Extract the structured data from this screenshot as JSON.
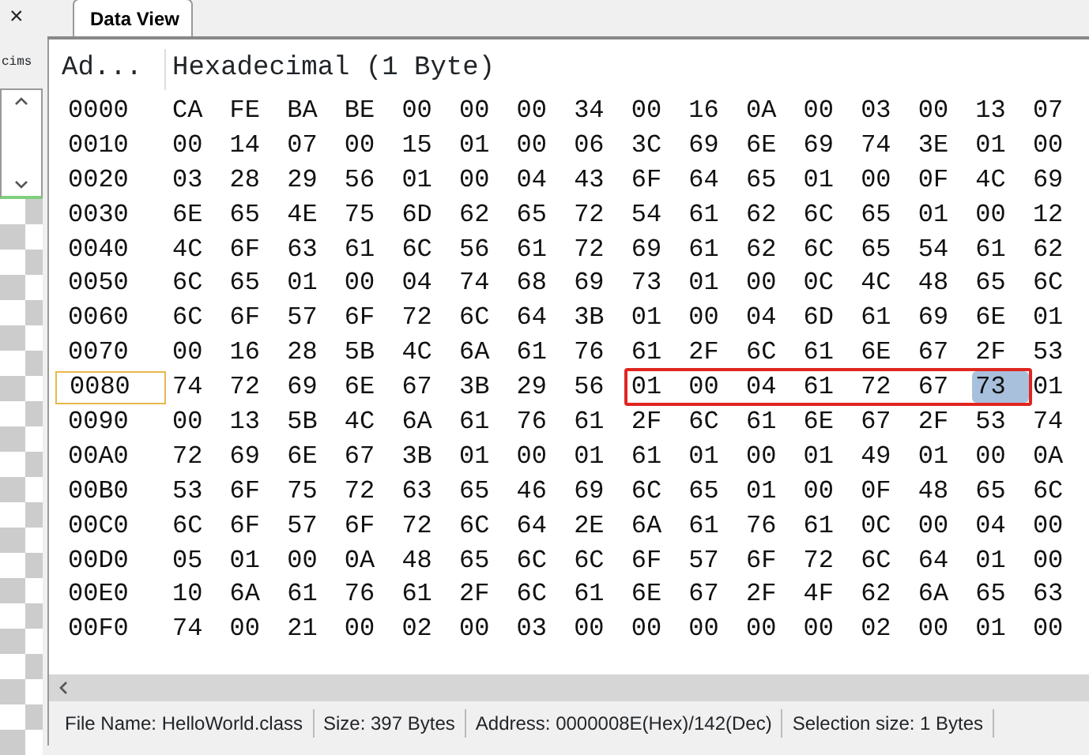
{
  "side_panel": {
    "close": "×",
    "label": "cims"
  },
  "tabs": [
    {
      "label": "Data View",
      "selected": true
    }
  ],
  "columns": [
    "Ad...",
    "Hexadecimal (1 Byte)"
  ],
  "rows": [
    {
      "address": "0000",
      "current": false,
      "groups": [
        {
          "boxed": false,
          "bytes": [
            "CA",
            "FE",
            "BA",
            "BE",
            "00",
            "00",
            "00",
            "34",
            "00",
            "16",
            "0A",
            "00",
            "03",
            "00",
            "13",
            "07"
          ]
        }
      ]
    },
    {
      "address": "0010",
      "current": false,
      "groups": [
        {
          "boxed": false,
          "bytes": [
            "00",
            "14",
            "07",
            "00",
            "15",
            "01",
            "00",
            "06",
            "3C",
            "69",
            "6E",
            "69",
            "74",
            "3E",
            "01",
            "00"
          ]
        }
      ]
    },
    {
      "address": "0020",
      "current": false,
      "groups": [
        {
          "boxed": false,
          "bytes": [
            "03",
            "28",
            "29",
            "56",
            "01",
            "00",
            "04",
            "43",
            "6F",
            "64",
            "65",
            "01",
            "00",
            "0F",
            "4C",
            "69"
          ]
        }
      ]
    },
    {
      "address": "0030",
      "current": false,
      "groups": [
        {
          "boxed": false,
          "bytes": [
            "6E",
            "65",
            "4E",
            "75",
            "6D",
            "62",
            "65",
            "72",
            "54",
            "61",
            "62",
            "6C",
            "65",
            "01",
            "00",
            "12"
          ]
        }
      ]
    },
    {
      "address": "0040",
      "current": false,
      "groups": [
        {
          "boxed": false,
          "bytes": [
            "4C",
            "6F",
            "63",
            "61",
            "6C",
            "56",
            "61",
            "72",
            "69",
            "61",
            "62",
            "6C",
            "65",
            "54",
            "61",
            "62"
          ]
        }
      ]
    },
    {
      "address": "0050",
      "current": false,
      "groups": [
        {
          "boxed": false,
          "bytes": [
            "6C",
            "65",
            "01",
            "00",
            "04",
            "74",
            "68",
            "69",
            "73",
            "01",
            "00",
            "0C",
            "4C",
            "48",
            "65",
            "6C"
          ]
        }
      ]
    },
    {
      "address": "0060",
      "current": false,
      "groups": [
        {
          "boxed": false,
          "bytes": [
            "6C",
            "6F",
            "57",
            "6F",
            "72",
            "6C",
            "64",
            "3B",
            "01",
            "00",
            "04",
            "6D",
            "61",
            "69",
            "6E",
            "01"
          ]
        }
      ]
    },
    {
      "address": "0070",
      "current": false,
      "groups": [
        {
          "boxed": false,
          "bytes": [
            "00",
            "16",
            "28",
            "5B",
            "4C",
            "6A",
            "61",
            "76",
            "61",
            "2F",
            "6C",
            "61",
            "6E",
            "67",
            "2F",
            "53"
          ]
        }
      ]
    },
    {
      "address": "0080",
      "current": true,
      "groups": [
        {
          "boxed": false,
          "bytes": [
            "74",
            "72",
            "69",
            "6E",
            "67",
            "3B",
            "29",
            "56"
          ]
        },
        {
          "boxed": true,
          "parts": [
            {
              "selected": false,
              "bytes": [
                "01",
                "00",
                "04",
                "61",
                "72",
                "67"
              ]
            },
            {
              "selected": true,
              "bytes": [
                "73"
              ]
            }
          ]
        },
        {
          "boxed": false,
          "bytes": [
            "01"
          ]
        }
      ]
    },
    {
      "address": "0090",
      "current": false,
      "groups": [
        {
          "boxed": false,
          "bytes": [
            "00",
            "13",
            "5B",
            "4C",
            "6A",
            "61",
            "76",
            "61",
            "2F",
            "6C",
            "61",
            "6E",
            "67",
            "2F",
            "53",
            "74"
          ]
        }
      ]
    },
    {
      "address": "00A0",
      "current": false,
      "groups": [
        {
          "boxed": false,
          "bytes": [
            "72",
            "69",
            "6E",
            "67",
            "3B",
            "01",
            "00",
            "01",
            "61",
            "01",
            "00",
            "01",
            "49",
            "01",
            "00",
            "0A"
          ]
        }
      ]
    },
    {
      "address": "00B0",
      "current": false,
      "groups": [
        {
          "boxed": false,
          "bytes": [
            "53",
            "6F",
            "75",
            "72",
            "63",
            "65",
            "46",
            "69",
            "6C",
            "65",
            "01",
            "00",
            "0F",
            "48",
            "65",
            "6C"
          ]
        }
      ]
    },
    {
      "address": "00C0",
      "current": false,
      "groups": [
        {
          "boxed": false,
          "bytes": [
            "6C",
            "6F",
            "57",
            "6F",
            "72",
            "6C",
            "64",
            "2E",
            "6A",
            "61",
            "76",
            "61",
            "0C",
            "00",
            "04",
            "00"
          ]
        }
      ]
    },
    {
      "address": "00D0",
      "current": false,
      "groups": [
        {
          "boxed": false,
          "bytes": [
            "05",
            "01",
            "00",
            "0A",
            "48",
            "65",
            "6C",
            "6C",
            "6F",
            "57",
            "6F",
            "72",
            "6C",
            "64",
            "01",
            "00"
          ]
        }
      ]
    },
    {
      "address": "00E0",
      "current": false,
      "groups": [
        {
          "boxed": false,
          "bytes": [
            "10",
            "6A",
            "61",
            "76",
            "61",
            "2F",
            "6C",
            "61",
            "6E",
            "67",
            "2F",
            "4F",
            "62",
            "6A",
            "65",
            "63"
          ]
        }
      ]
    },
    {
      "address": "00F0",
      "current": false,
      "groups": [
        {
          "boxed": false,
          "bytes": [
            "74",
            "00",
            "21",
            "00",
            "02",
            "00",
            "03",
            "00",
            "00",
            "00",
            "00",
            "00",
            "02",
            "00",
            "01",
            "00"
          ]
        }
      ]
    }
  ],
  "status_bar": [
    "File Name: HelloWorld.class",
    "Size: 397 Bytes",
    "Address: 0000008E(Hex)/142(Dec)",
    "Selection size: 1 Bytes"
  ]
}
